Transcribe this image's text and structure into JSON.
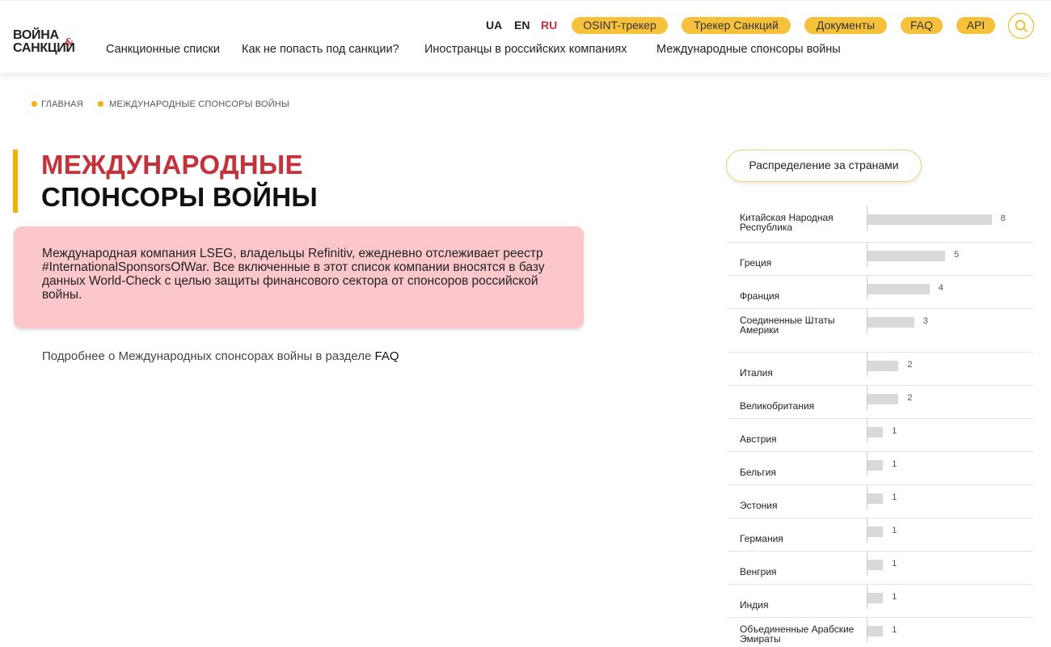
{
  "header": {
    "logo_line1": "ВОЙНА",
    "logo_amp": "&",
    "logo_line2": "САНКЦИИ",
    "languages": [
      "UA",
      "EN",
      "RU"
    ],
    "active_language": "RU",
    "pills": [
      "OSINT-трекер",
      "Трекер Санкций",
      "Документы",
      "FAQ",
      "API"
    ],
    "nav": [
      "Санкционные списки",
      "Как не попасть под санкции?",
      "Иностранцы в российских компаниях",
      "Международные спонсоры войны"
    ],
    "search_icon": "search-icon"
  },
  "breadcrumb": [
    "ГЛАВНАЯ",
    "МЕЖДУНАРОДНЫЕ СПОНСОРЫ ВОЙНЫ"
  ],
  "title": {
    "line1": "МЕЖДУНАРОДНЫЕ",
    "line2": "СПОНСОРЫ ВОЙНЫ"
  },
  "info": "Международная компания LSEG, владельцы Refinitiv, ежедневно отслеживает реестр #InternationalSponsorsOfWar. Все включенные в этот список компании вносятся в базу данных World-Check с целью защиты финансового сектора от спонсоров российской войны.",
  "more": {
    "text": "Подробнее о Международных спонсорах войны в разделе ",
    "link": "FAQ"
  },
  "distribution": {
    "button": "Распределение за странами",
    "rows": [
      {
        "name": "Китайская Народная Республика",
        "value": 8
      },
      {
        "name": "Греция",
        "value": 5
      },
      {
        "name": "Франция",
        "value": 4
      },
      {
        "name": "Соединенные Штаты Америки",
        "value": 3
      },
      {
        "name": "Италия",
        "value": 2
      },
      {
        "name": "Великобритания",
        "value": 2
      },
      {
        "name": "Австрия",
        "value": 1
      },
      {
        "name": "Бельгия",
        "value": 1
      },
      {
        "name": "Эстония",
        "value": 1
      },
      {
        "name": "Германия",
        "value": 1
      },
      {
        "name": "Венгрия",
        "value": 1
      },
      {
        "name": "Индия",
        "value": 1
      },
      {
        "name": "Объединенные Арабские Эмираты",
        "value": 1
      }
    ]
  },
  "colors": {
    "accent_yellow": "#f7c23a",
    "accent_red": "#c8303a",
    "info_bg": "#fcc7cb"
  }
}
